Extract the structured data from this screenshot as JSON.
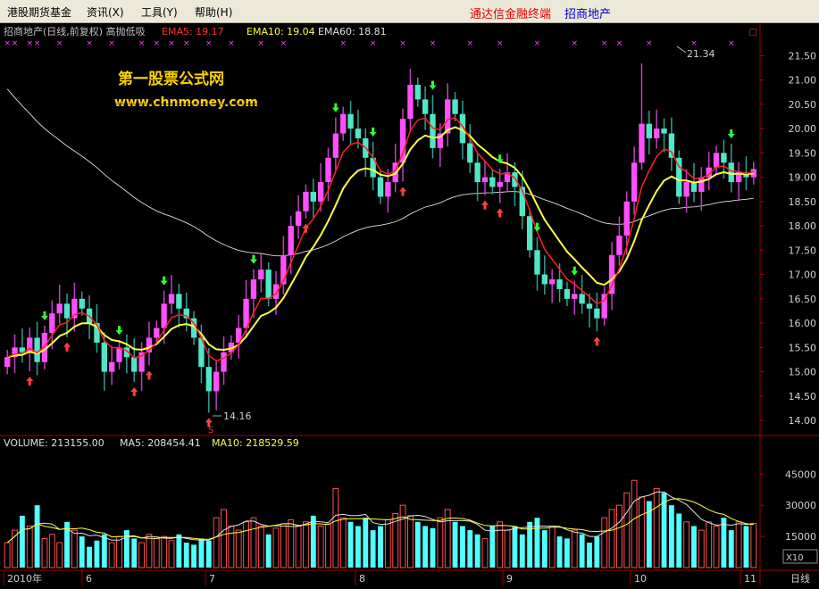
{
  "menu": [
    {
      "label": "港股期货基金"
    },
    {
      "label": "资讯(X)"
    },
    {
      "label": "工具(Y)"
    },
    {
      "label": "帮助(H)"
    }
  ],
  "brand": {
    "app": "通达信金融终端",
    "stock": "招商地产"
  },
  "header": {
    "title": "招商地产(日线,前复权) 高抛低吸",
    "ema5_label": "EMA5: 19.17",
    "ema10_label": "EMA10: 19.04",
    "ema60_label": "EMA60: 18.81"
  },
  "volume_header": {
    "volume_label": "VOLUME: 213155.00",
    "ma5_label": "MA5: 208454.41",
    "ma10_label": "MA10: 218529.59"
  },
  "watermark": {
    "line1": "第一股票公式网",
    "line2": "www.chnmoney.com"
  },
  "annotations": {
    "high": "21.34",
    "low": "14.16",
    "s_mark": "S"
  },
  "period_label": "日线",
  "zoom_label": "X10",
  "colors": {
    "up": "#ff50ff",
    "down": "#50e6c8",
    "ema5": "#ff2020",
    "ema10": "#ffff40",
    "ema60": "#e0e0e0",
    "vol_up": "#ff5050",
    "vol_down": "#50ffff"
  },
  "chart_data": [
    {
      "type": "candlestick",
      "title": "招商地产(日线,前复权)",
      "x_labels": [
        "2010年",
        "6",
        "7",
        "8",
        "9",
        "10",
        "11"
      ],
      "ylim": [
        13.8,
        21.8
      ],
      "y_ticks": [
        14.0,
        14.5,
        15.0,
        15.5,
        16.0,
        16.5,
        17.0,
        17.5,
        18.0,
        18.5,
        19.0,
        19.5,
        20.0,
        20.5,
        21.0,
        21.5
      ],
      "close_approx": [
        15.3,
        15.5,
        15.4,
        15.7,
        15.2,
        15.8,
        16.2,
        16.4,
        16.1,
        16.5,
        16.3,
        16.0,
        15.6,
        15.0,
        15.2,
        15.5,
        15.3,
        15.0,
        15.4,
        15.7,
        15.9,
        16.4,
        16.6,
        16.3,
        16.1,
        15.7,
        15.1,
        14.6,
        15.0,
        15.4,
        15.6,
        15.9,
        16.5,
        16.9,
        17.1,
        16.5,
        16.8,
        17.4,
        18.0,
        18.3,
        18.7,
        18.5,
        18.9,
        19.4,
        19.9,
        20.3,
        20.0,
        19.8,
        19.4,
        19.0,
        18.6,
        18.9,
        19.3,
        20.2,
        20.9,
        20.6,
        20.3,
        19.6,
        19.9,
        20.6,
        20.3,
        19.7,
        19.3,
        18.9,
        19.0,
        18.8,
        18.9,
        19.1,
        18.8,
        18.2,
        17.5,
        17.0,
        16.8,
        16.9,
        16.7,
        16.5,
        16.6,
        16.4,
        16.3,
        16.1,
        16.6,
        17.4,
        17.8,
        18.5,
        19.3,
        20.1,
        19.8,
        20.0,
        19.9,
        19.4,
        18.6,
        18.9,
        18.7,
        19.0,
        19.2,
        19.5,
        19.3,
        18.9,
        19.1,
        19.0,
        19.17
      ],
      "high": 21.34,
      "low": 14.16,
      "series": [
        {
          "name": "EMA5",
          "last": 19.17
        },
        {
          "name": "EMA10",
          "last": 19.04
        },
        {
          "name": "EMA60",
          "last": 18.81
        }
      ]
    },
    {
      "type": "bar",
      "title": "VOLUME",
      "ylim": [
        0,
        55000
      ],
      "y_ticks": [
        15000,
        30000,
        45000
      ],
      "values_approx": [
        12000,
        18000,
        25000,
        20000,
        30000,
        14000,
        16000,
        12000,
        22000,
        18000,
        15000,
        10000,
        13000,
        16000,
        12000,
        15000,
        18000,
        14000,
        12000,
        16000,
        14000,
        15000,
        13000,
        16000,
        12000,
        11000,
        14000,
        13000,
        24000,
        28000,
        20000,
        18000,
        22000,
        24000,
        20000,
        16000,
        19000,
        21000,
        23000,
        20000,
        22000,
        25000,
        20000,
        21000,
        38000,
        24000,
        22000,
        20000,
        24000,
        18000,
        20000,
        23000,
        26000,
        30000,
        25000,
        22000,
        20000,
        19000,
        24000,
        28000,
        22000,
        20000,
        18000,
        16000,
        14000,
        20000,
        22000,
        18000,
        20000,
        16000,
        22000,
        24000,
        18000,
        20000,
        15000,
        14000,
        18000,
        16000,
        12000,
        15000,
        24000,
        28000,
        30000,
        36000,
        42000,
        34000,
        32000,
        38000,
        36000,
        30000,
        26000,
        22000,
        20000,
        18000,
        22000,
        20000,
        24000,
        18000,
        22000,
        20000,
        21300
      ],
      "series": [
        {
          "name": "VOLUME",
          "last": 213155.0
        },
        {
          "name": "MA5",
          "last": 208454.41
        },
        {
          "name": "MA10",
          "last": 218529.59
        }
      ]
    }
  ]
}
